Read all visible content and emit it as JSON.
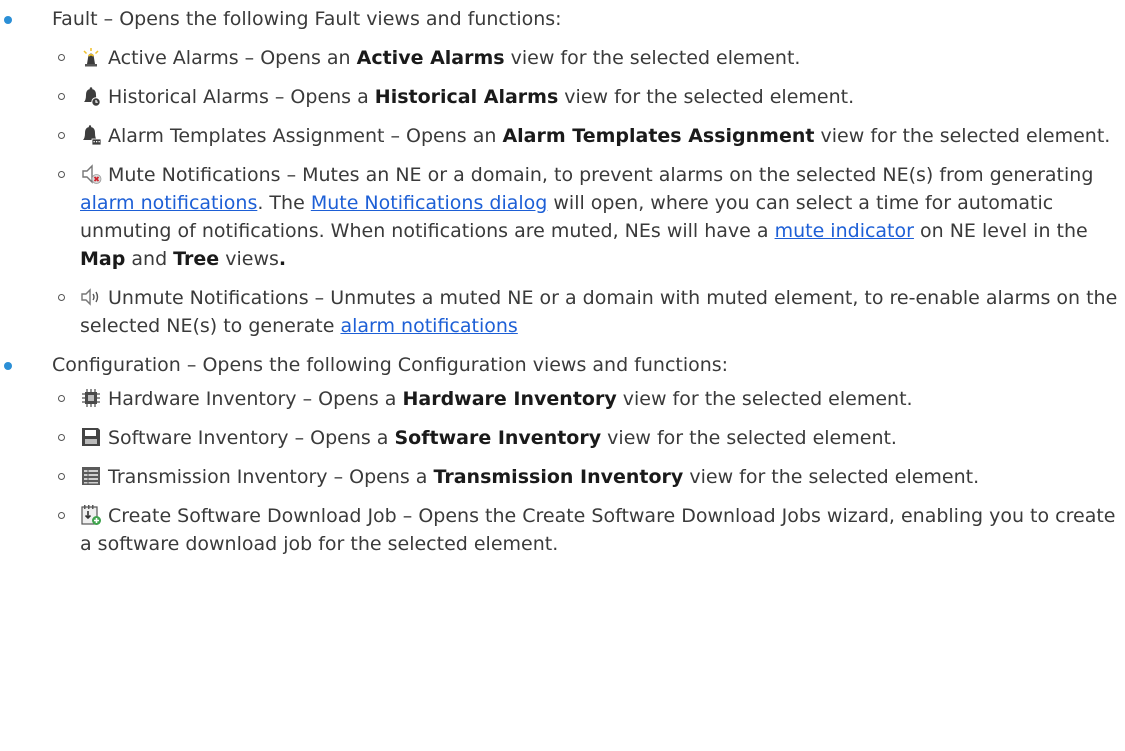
{
  "fault": {
    "label": "Fault",
    "desc": " – Opens the following Fault views and functions:",
    "items": [
      {
        "icon": "active-alarms-icon",
        "name": "Active Alarms",
        "pre": " – Opens an ",
        "bold": "Active Alarms",
        "post": " view for the selected element."
      },
      {
        "icon": "historical-alarms-icon",
        "name": "Historical Alarms",
        "pre": " – Opens a ",
        "bold": "Historical Alarms",
        "post": " view for the selected element."
      },
      {
        "icon": "alarm-templates-icon",
        "name": "Alarm Templates Assignment",
        "pre": " – Opens an ",
        "bold": "Alarm Templates Assignment",
        "post": " view for the selected element."
      }
    ],
    "mute": {
      "icon": "mute-notifications-icon",
      "name": "Mute Notifications",
      "t1": " – Mutes an NE or a domain, to prevent alarms on the selected NE(s) from generating ",
      "link1": "alarm notifications",
      "t2": ". The ",
      "link2": "Mute Notifications dialog",
      "t3": " will open, where you can select a time for automatic unmuting of notifications. When notifications are muted, NEs will have a ",
      "link3": "mute indicator",
      "t4": " on NE level in the ",
      "bold1": "Map",
      "t5": " and ",
      "bold2": "Tree",
      "t6": " views",
      "bold3": "."
    },
    "unmute": {
      "icon": "unmute-notifications-icon",
      "name": "Unmute Notifications",
      "t1": " – Unmutes a muted NE or a domain with muted element, to re-enable alarms on the selected NE(s) to generate ",
      "link1": "alarm notifications"
    }
  },
  "configuration": {
    "label": "Configuration",
    "desc": " – Opens the following Configuration views and functions:",
    "items": [
      {
        "icon": "hardware-inventory-icon",
        "name": "Hardware Inventory",
        "pre": " – Opens a ",
        "bold": "Hardware Inventory",
        "post": " view for the selected element."
      },
      {
        "icon": "software-inventory-icon",
        "name": "Software Inventory",
        "pre": " – Opens a ",
        "bold": "Software Inventory",
        "post": " view for the selected element."
      },
      {
        "icon": "transmission-inventory-icon",
        "name": "Transmission Inventory",
        "pre": " – Opens a ",
        "bold": "Transmission Inventory",
        "post": " view for the selected element."
      }
    ],
    "download": {
      "icon": "create-download-job-icon",
      "name": "Create Software Download Job",
      "text": " – Opens the Create Software Download Jobs wizard, enabling you to create a software download job for the selected element."
    }
  }
}
